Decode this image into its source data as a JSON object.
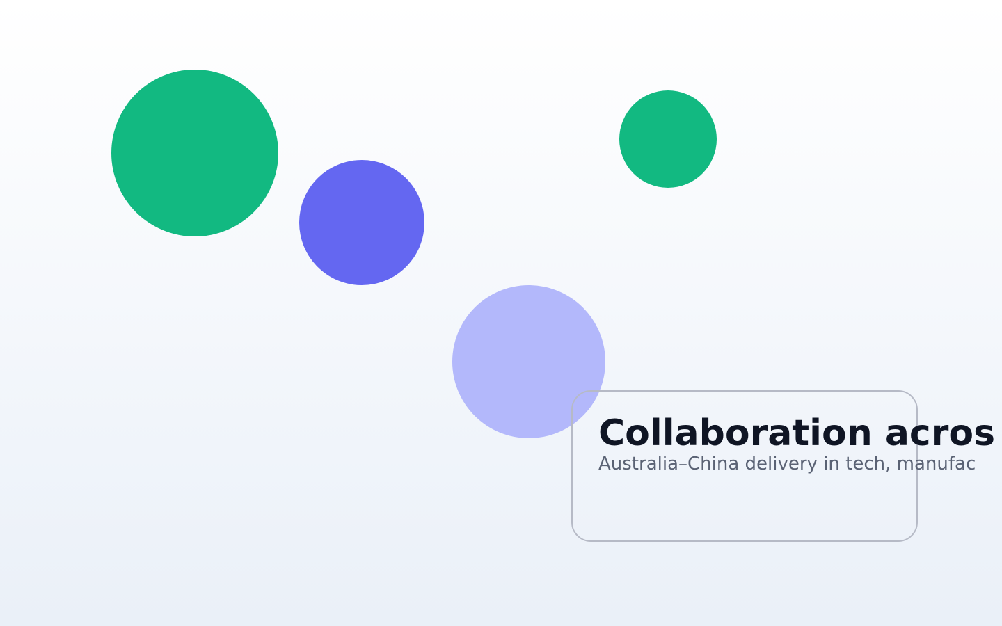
{
  "colors": {
    "green": "#12b981",
    "indigo": "#6467f1",
    "lavender": "#b3b8fb",
    "card_border": "#b6bac6",
    "title_text": "#0f1524",
    "subtitle_text": "#5a6274",
    "background_top": "#ffffff",
    "background_bottom": "#eaf0f8"
  },
  "card": {
    "title": "Collaboration acros",
    "subtitle": "Australia–China delivery in tech, manufac"
  }
}
